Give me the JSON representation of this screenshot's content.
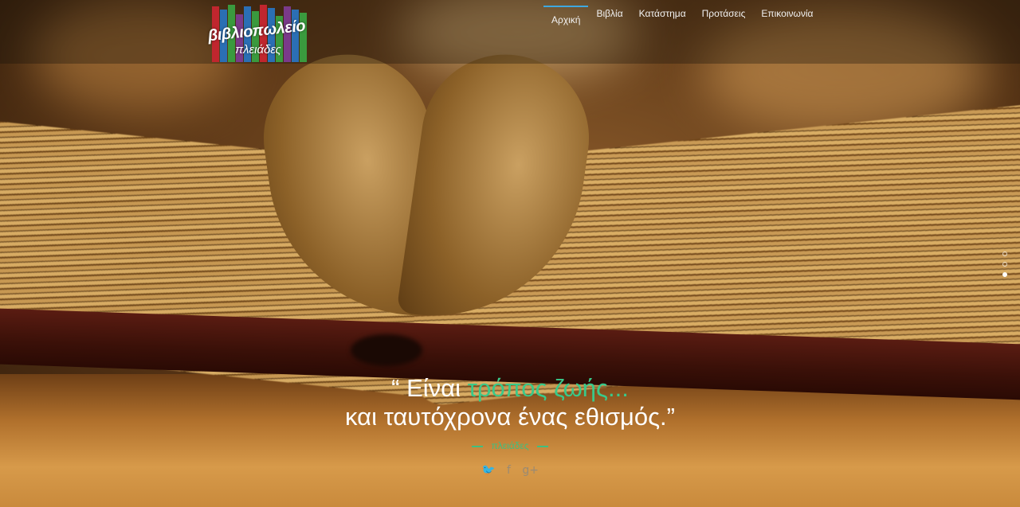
{
  "logo": {
    "title": "βιβλιοπωλείο",
    "subtitle": "πλειάδες",
    "bar_colors": [
      "#c0262e",
      "#2b6fb4",
      "#3a9a3e",
      "#7a3a8a",
      "#2b6fb4",
      "#3a9a3e",
      "#c0262e",
      "#2b6fb4",
      "#3a9a3e",
      "#7a3a8a",
      "#2b6fb4",
      "#3a9a3e"
    ]
  },
  "nav": {
    "items": [
      {
        "label": "Αρχική",
        "active": true
      },
      {
        "label": "Βιβλία"
      },
      {
        "label": "Κατάστημα"
      },
      {
        "label": "Προτάσεις"
      },
      {
        "label": "Επικοινωνία"
      }
    ]
  },
  "slider": {
    "slides": 3,
    "active_index": 2
  },
  "quote": {
    "open": "“ Είναι ",
    "accent": "τρόπος ζωής...",
    "line2": "και ταυτόχρονα ένας εθισμός.”",
    "author": "πλειάδες"
  },
  "social": [
    {
      "icon": "twitter-icon",
      "glyph": "🐦"
    },
    {
      "icon": "facebook-icon",
      "glyph": "f"
    },
    {
      "icon": "google-plus-icon",
      "glyph": "g+"
    }
  ],
  "colors": {
    "accent": "#39c98a",
    "nav_active": "#3ea8e0"
  }
}
